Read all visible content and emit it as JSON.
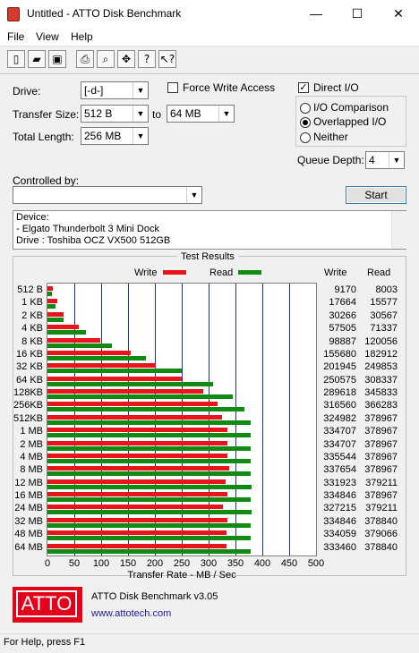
{
  "window": {
    "title": "Untitled - ATTO Disk Benchmark",
    "minimize": "—",
    "maximize": "☐",
    "close": "✕"
  },
  "menu": [
    "File",
    "View",
    "Help"
  ],
  "toolbar_icons": [
    "new-icon",
    "open-icon",
    "save-icon",
    "print-icon",
    "print-preview-icon",
    "move-icon",
    "help-icon",
    "context-help-icon"
  ],
  "settings": {
    "drive_label": "Drive:",
    "drive_value": "[-d-]",
    "transfer_size_label": "Transfer Size:",
    "transfer_from": "512 B",
    "to_label": "to",
    "transfer_to": "64 MB",
    "total_length_label": "Total Length:",
    "total_length_value": "256 MB",
    "force_write_label": "Force Write Access",
    "force_write_checked": false,
    "direct_io_label": "Direct I/O",
    "direct_io_checked": true,
    "io_comparison_label": "I/O Comparison",
    "overlapped_io_label": "Overlapped I/O",
    "neither_label": "Neither",
    "selected_mode": "Overlapped I/O",
    "queue_depth_label": "Queue Depth:",
    "queue_depth_value": "4",
    "controlled_by_label": "Controlled by:",
    "controlled_by_value": "",
    "start_label": "Start"
  },
  "device": {
    "line1": "Device:",
    "line2": " - Elgato Thunderbolt 3 Mini Dock",
    "line3": "Drive :  Toshiba OCZ VX500 512GB"
  },
  "results": {
    "title": "Test Results",
    "write_legend": "Write",
    "read_legend": "Read",
    "write_col": "Write",
    "read_col": "Read",
    "write_color": "#e8141b",
    "read_color": "#118a11"
  },
  "chart_data": {
    "type": "bar",
    "orientation": "horizontal",
    "categories": [
      "512 B",
      "1 KB",
      "2 KB",
      "4 KB",
      "8 KB",
      "16 KB",
      "32 KB",
      "64 KB",
      "128KB",
      "256KB",
      "512KB",
      "1 MB",
      "2 MB",
      "4 MB",
      "8 MB",
      "12 MB",
      "16 MB",
      "24 MB",
      "32 MB",
      "48 MB",
      "64 MB"
    ],
    "series": [
      {
        "name": "Write",
        "values": [
          9170,
          17664,
          30266,
          57505,
          98887,
          155680,
          201945,
          250575,
          289618,
          316560,
          324982,
          334707,
          334707,
          335544,
          337654,
          331923,
          334846,
          327215,
          334846,
          334059,
          333460
        ]
      },
      {
        "name": "Read",
        "values": [
          8003,
          15577,
          30567,
          71337,
          120056,
          182912,
          249853,
          308337,
          345833,
          366283,
          378967,
          378967,
          378967,
          378967,
          378967,
          379211,
          378967,
          379211,
          378840,
          379066,
          378840
        ]
      }
    ],
    "xlabel": "Transfer Rate - MB / Sec",
    "xlim": [
      0,
      500
    ],
    "xticks": [
      0,
      50,
      100,
      150,
      200,
      250,
      300,
      350,
      400,
      450,
      500
    ],
    "grid": true
  },
  "footer": {
    "logo_text": "ATTO",
    "product": "ATTO Disk Benchmark v3.05",
    "url": "www.attotech.com"
  },
  "status": "For Help, press F1"
}
